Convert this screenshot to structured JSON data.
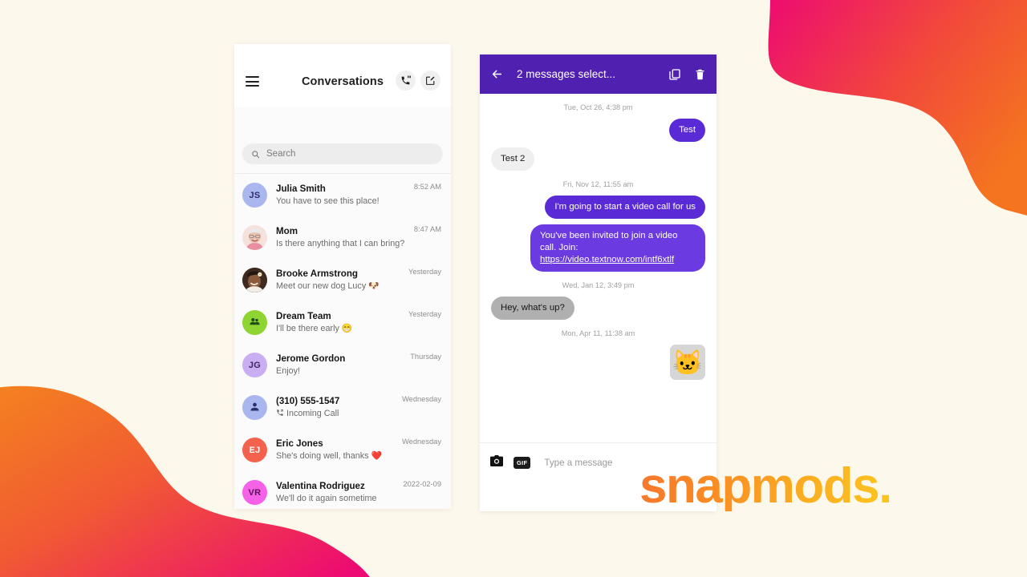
{
  "theme": {
    "page_background": "#fdf8ec",
    "header_purple": "#5020b0",
    "bubble_purple": "#5a2ad6",
    "blob_pink": "#ed0a72",
    "blob_orange": "#f4741f"
  },
  "watermark": {
    "text": "snapmods."
  },
  "conversations_panel": {
    "header": {
      "menu_icon": "hamburger-icon",
      "title": "Conversations",
      "call_icon": "phone-dialpad-icon",
      "compose_icon": "compose-icon"
    },
    "search": {
      "icon": "search-icon",
      "placeholder": "Search",
      "value": ""
    },
    "items": [
      {
        "name": "Julia Smith",
        "snippet": "You have to see this place!",
        "time": "8:52 AM",
        "avatar_type": "initials",
        "initials": "JS",
        "avatar_bg": "#a9b7ee",
        "avatar_fg": "#2b2f6b"
      },
      {
        "name": "Mom",
        "snippet": "Is there anything that I can bring?",
        "time": "8:47 AM",
        "avatar_type": "photo",
        "initials": "",
        "avatar_bg": "#f3d9d4",
        "avatar_fg": "#5a3a34"
      },
      {
        "name": "Brooke Armstrong",
        "snippet": "Meet our new dog Lucy 🐶",
        "time": "Yesterday",
        "avatar_type": "photo",
        "initials": "",
        "avatar_bg": "#4a3429",
        "avatar_fg": "#ffffff"
      },
      {
        "name": "Dream Team",
        "snippet": "I'll be there early 😁",
        "time": "Yesterday",
        "avatar_type": "group",
        "initials": "",
        "avatar_bg": "#8ed433",
        "avatar_fg": "#1d4d12"
      },
      {
        "name": "Jerome Gordon",
        "snippet": "Enjoy!",
        "time": "Thursday",
        "avatar_type": "initials",
        "initials": "JG",
        "avatar_bg": "#c9aef2",
        "avatar_fg": "#3d2566"
      },
      {
        "name": "(310) 555-1547",
        "snippet": "Incoming Call",
        "snippet_icon": "incoming-call-icon",
        "time": "Wednesday",
        "avatar_type": "person",
        "initials": "",
        "avatar_bg": "#a9b7ee",
        "avatar_fg": "#2b2f6b"
      },
      {
        "name": "Eric Jones",
        "snippet": "She's doing well, thanks ❤️",
        "time": "Wednesday",
        "avatar_type": "initials",
        "initials": "EJ",
        "avatar_bg": "#f4614c",
        "avatar_fg": "#ffffff"
      },
      {
        "name": "Valentina Rodriguez",
        "snippet": "We'll do it again sometime",
        "time": "2022-02-09",
        "avatar_type": "initials",
        "initials": "VR",
        "avatar_bg": "#f562e8",
        "avatar_fg": "#5e1158"
      }
    ]
  },
  "chat_panel": {
    "header": {
      "back_icon": "back-arrow-icon",
      "title": "2 messages select...",
      "copy_icon": "copy-icon",
      "delete_icon": "trash-icon"
    },
    "thread": [
      {
        "kind": "separator",
        "text": "Tue, Oct 26, 4:38 pm"
      },
      {
        "kind": "message",
        "side": "out",
        "text": "Test",
        "selected": false
      },
      {
        "kind": "message",
        "side": "in",
        "text": "Test 2",
        "selected": false
      },
      {
        "kind": "separator",
        "text": "Fri, Nov 12, 11:55 am"
      },
      {
        "kind": "message",
        "side": "out",
        "text": "I'm going to start a video call for us",
        "selected": false
      },
      {
        "kind": "message",
        "side": "out",
        "selected": true,
        "text": "You've been invited to join a video call. Join: ",
        "link": "https://video.textnow.com/intf6xtlf"
      },
      {
        "kind": "separator",
        "text": "Wed, Jan 12, 3:49 pm"
      },
      {
        "kind": "message",
        "side": "in",
        "text": "Hey, what's up?",
        "selected": true
      },
      {
        "kind": "separator",
        "text": "Mon, Apr 11, 11:38 am"
      },
      {
        "kind": "sticker",
        "side": "out",
        "glyph": "🐱"
      }
    ],
    "input_bar": {
      "camera_icon": "camera-icon",
      "gif_label": "GIF",
      "placeholder": "Type a message",
      "value": ""
    }
  }
}
